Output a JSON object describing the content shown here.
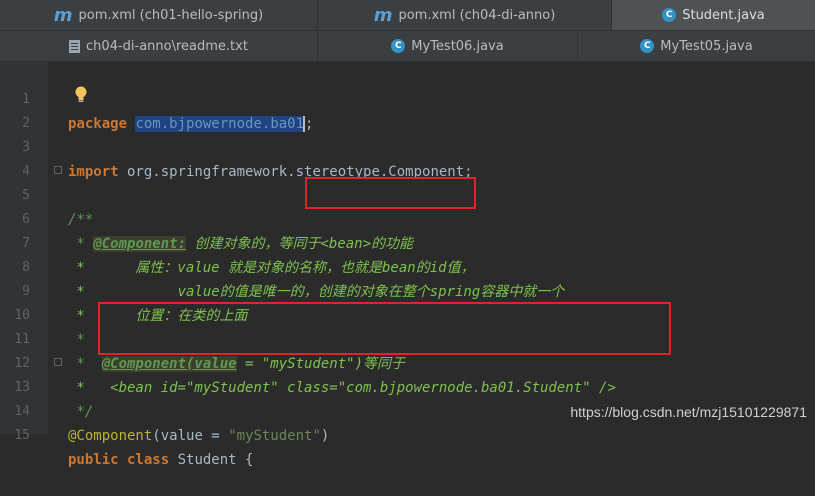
{
  "tabs_row1": [
    {
      "label": "pom.xml (ch01-hello-spring)",
      "icon": "maven-icon"
    },
    {
      "label": "pom.xml (ch04-di-anno)",
      "icon": "maven-icon"
    },
    {
      "label": "Student.java",
      "icon": "java-class-icon"
    }
  ],
  "tabs_row2": [
    {
      "label": "ch04-di-anno\\readme.txt",
      "icon": "text-file-icon"
    },
    {
      "label": "MyTest06.java",
      "icon": "java-class-icon"
    },
    {
      "label": "MyTest05.java",
      "icon": "java-class-icon"
    }
  ],
  "line_numbers": [
    "1",
    "2",
    "3",
    "4",
    "5",
    "6",
    "7",
    "8",
    "9",
    "10",
    "11",
    "12",
    "13",
    "14",
    "15"
  ],
  "code": {
    "l1_kw": "package",
    "l1_pkg": "com.bjpowernode.ba01",
    "l1_end": ";",
    "l3_kw": "import",
    "l3_rest": " org.springframework.stereotype.Component;",
    "l5": "/**",
    "l6_star": " * ",
    "l6_tag": "@Component:",
    "l6_text": " 创建对象的，",
    "l6_box": "等同于<bean>的功能",
    "l7": " *      属性：value 就是对象的名称，也就是bean的id值，",
    "l8": " *           value的值是唯一的，创建的对象在整个spring容器中就一个",
    "l9": " *      位置：在类的上面",
    "l10": " *",
    "l11_star": " *  ",
    "l11_tag": "@Component(value",
    "l11_rest": " = \"myStudent\")等同于",
    "l12": " *   <bean id=\"myStudent\" class=\"com.bjpowernode.ba01.Student\" />",
    "l13": " */",
    "l14_ann": "@Component",
    "l14_paren": "(value = ",
    "l14_str": "\"myStudent\"",
    "l14_close": ")",
    "l15_kw": "public class",
    "l15_rest": " Student {"
  },
  "watermark": "https://blog.csdn.net/mzj15101229871"
}
